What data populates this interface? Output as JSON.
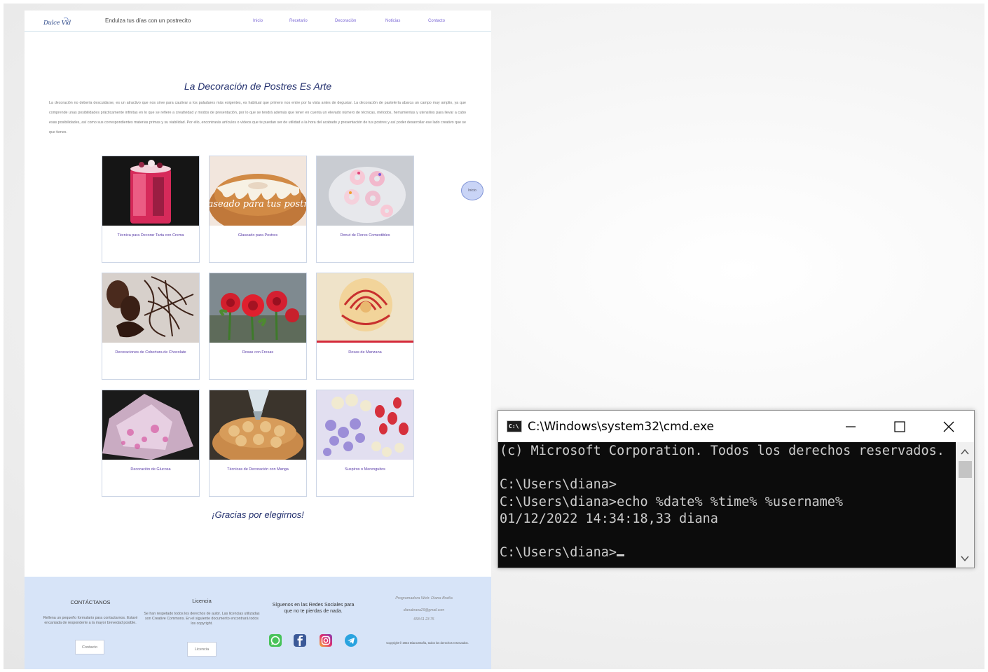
{
  "site": {
    "logo_text": "Dulce Vida",
    "slogan": "Endulza tus días con un postrecito",
    "nav": [
      "Inicio",
      "Recetario",
      "Decoración",
      "Noticias",
      "Contacto"
    ],
    "title": "La Decoración de Postres Es Arte",
    "intro": "La decoración no debería descuidarse, es un atractivo que nos sirve para cautivar a los paladares más exigentes, es habitual que primero nos entre por la vista antes de degustar. La decoración de pastelería abarca un campo muy amplio, ya que comprende unas posibilidades prácticamente infinitas en lo que se refiere a creatividad y modos de presentación, por lo que se tendrá además que tener en cuenta un elevado número de técnicas, métodos, herramientas y utensilios para llevar a cabo esas posibilidades, así como sus correspondientes materias primas y su viabilidad. Por ello, encontrarás artículos o vídeos que te puedan ser de utilidad a la hora del acabado y presentación de tus postres y así poder desarrollar ese lado creativo que se que tienes.",
    "cards": [
      {
        "caption": "Técnica para Decorar Tarta con Crema",
        "overlay": ""
      },
      {
        "caption": "Glaseado para Postres",
        "overlay": "Glaseado para tus postres"
      },
      {
        "caption": "Donut de Flores Comestibles",
        "overlay": ""
      },
      {
        "caption": "Decoraciones de Cobertura de Chocolate",
        "overlay": ""
      },
      {
        "caption": "Rosas con Fresas",
        "overlay": ""
      },
      {
        "caption": "Rosas de Manzana",
        "overlay": ""
      },
      {
        "caption": "Decoración de Glucosa",
        "overlay": ""
      },
      {
        "caption": "Técnicas de Decoración con Manga",
        "overlay": ""
      },
      {
        "caption": "Suspiros o Merenguitos",
        "overlay": ""
      }
    ],
    "inicio_button": "Inicio",
    "thanks": "¡Gracias por elegirnos!",
    "footer": {
      "contact_head": "CONTÁCTANOS",
      "contact_text": "Rellena un pequeño formulario para contactarnos. Estaré encantada de responderte a la mayor brevedad posible.",
      "contact_btn": "Contacto",
      "licence_head": "Licencia",
      "licence_text": "Se han respetado todos los derechos de autor. Las licencias utilizadas son Creative Commons. En el siguiente documento encontrará todos los copyright.",
      "licence_btn": "Licencia",
      "social_head": "Síguenos en las Redes Sociales para que no te pierdas de nada.",
      "social_icons": [
        "whatsapp-icon",
        "facebook-icon",
        "instagram-icon",
        "telegram-icon"
      ],
      "author": "Programadora Web: Diana Braña",
      "email": "dianabrana29@gmail.com",
      "phone": "658 61 23 75",
      "copyright": "Copyright © 2022 Diana Braña, todos los derechos reservados."
    }
  },
  "cmd": {
    "title": "C:\\Windows\\system32\\cmd.exe",
    "icon_text": "C:\\",
    "lines": [
      "(c) Microsoft Corporation. Todos los derechos reservados.",
      "",
      "C:\\Users\\diana>",
      "C:\\Users\\diana>echo %date% %time% %username%",
      "01/12/2022 14:34:18,33 diana",
      "",
      "C:\\Users\\diana>"
    ]
  },
  "colors": {
    "accent": "#7d6ad6",
    "title_blue": "#23306e",
    "footer_bg": "#d7e4f8",
    "cmd_bg": "#0c0c0c",
    "cmd_text": "#cccccc"
  }
}
